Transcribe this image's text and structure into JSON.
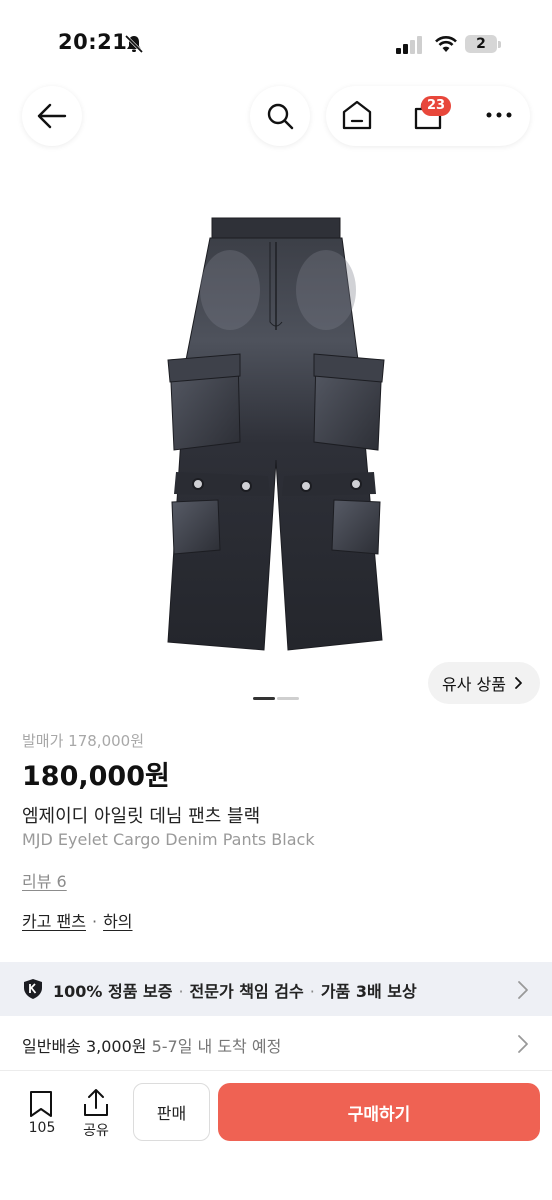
{
  "status_bar": {
    "time": "20:21",
    "battery": "2"
  },
  "header": {
    "cart_count": "23"
  },
  "product": {
    "similar_label": "유사 상품",
    "release_price": "발매가 178,000원",
    "price": "180,000원",
    "name_kr": "엠제이디 아일릿 데님 팬츠 블랙",
    "name_en": "MJD Eyelet Cargo Denim Pants Black",
    "review": "리뷰 6",
    "category": [
      "카고 팬츠",
      "하의"
    ],
    "category_sep": "·"
  },
  "guarantee": {
    "items": [
      "100% 정품 보증",
      "전문가 책임 검수",
      "가품 3배 보상"
    ],
    "sep": "·"
  },
  "shipping": {
    "label": "일반배송 3,000원",
    "eta": "5-7일 내 도착 예정"
  },
  "bottom_bar": {
    "bookmark_count": "105",
    "share_label": "공유",
    "sell_label": "판매",
    "buy_label": "구매하기"
  },
  "colors": {
    "accent": "#ef6253",
    "badge": "#e8473b",
    "banner_bg": "#eef0f5"
  },
  "icons": [
    "back-arrow-icon",
    "search-icon",
    "home-icon",
    "cart-icon",
    "more-icon",
    "bell-off-icon",
    "signal-icon",
    "wifi-icon",
    "shield-icon",
    "chevron-right-icon",
    "bookmark-icon",
    "share-icon"
  ]
}
